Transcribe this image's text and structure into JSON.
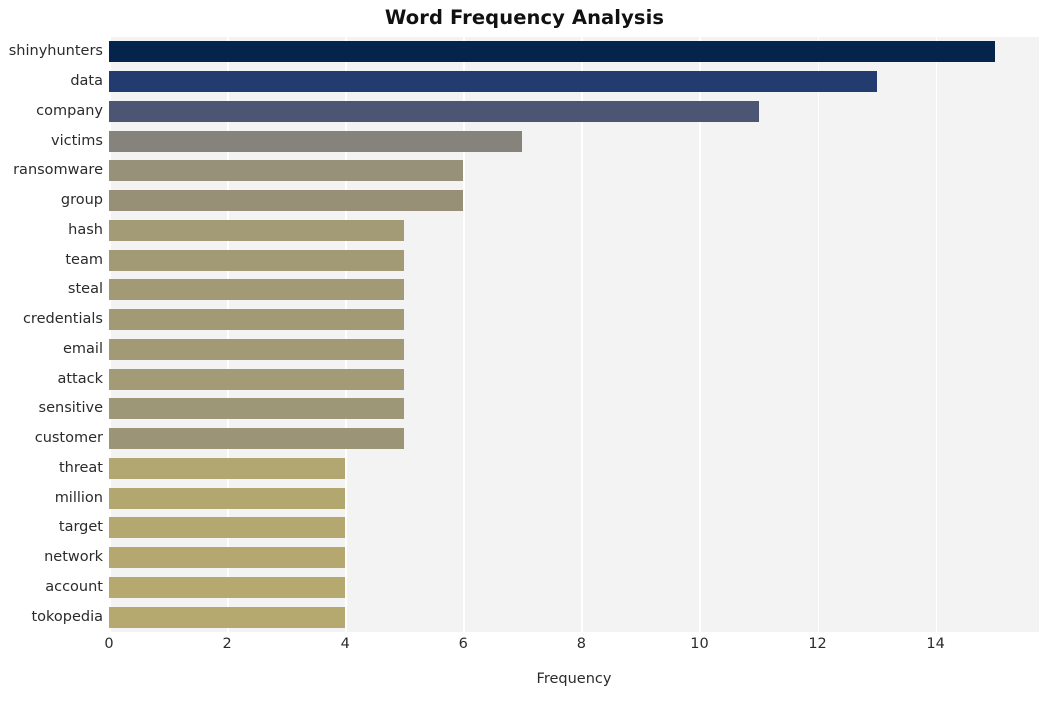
{
  "chart_data": {
    "type": "bar",
    "orientation": "horizontal",
    "title": "Word Frequency Analysis",
    "xlabel": "Frequency",
    "ylabel": "",
    "categories": [
      "shinyhunters",
      "data",
      "company",
      "victims",
      "ransomware",
      "group",
      "hash",
      "team",
      "steal",
      "credentials",
      "email",
      "attack",
      "sensitive",
      "customer",
      "threat",
      "million",
      "target",
      "network",
      "account",
      "tokopedia"
    ],
    "values": [
      15,
      13,
      11,
      7,
      6,
      6,
      5,
      5,
      5,
      5,
      5,
      5,
      5,
      5,
      4,
      4,
      4,
      4,
      4,
      4
    ],
    "bar_colors": [
      "#04244c",
      "#233c70",
      "#4c5574",
      "#85837c",
      "#98917a",
      "#979077",
      "#a39b76",
      "#a29a75",
      "#a29a75",
      "#a29a75",
      "#a29a75",
      "#a39b76",
      "#9d9677",
      "#9c9476",
      "#b3a771",
      "#b3a770",
      "#b4a870",
      "#b4a870",
      "#b5a96f",
      "#b5a96f"
    ],
    "xlim": [
      0,
      15.75
    ],
    "ylim_categories": 20,
    "xticks": [
      0,
      2,
      4,
      6,
      8,
      10,
      12,
      14
    ],
    "xtick_labels": [
      "0",
      "2",
      "4",
      "6",
      "8",
      "10",
      "12",
      "14"
    ],
    "grid": true,
    "grid_axis": "x",
    "grid_color": "#ffffff",
    "plot_background": "#f3f3f4",
    "figure_background": "#ffffff",
    "legend": null,
    "style": "whitegrid"
  }
}
